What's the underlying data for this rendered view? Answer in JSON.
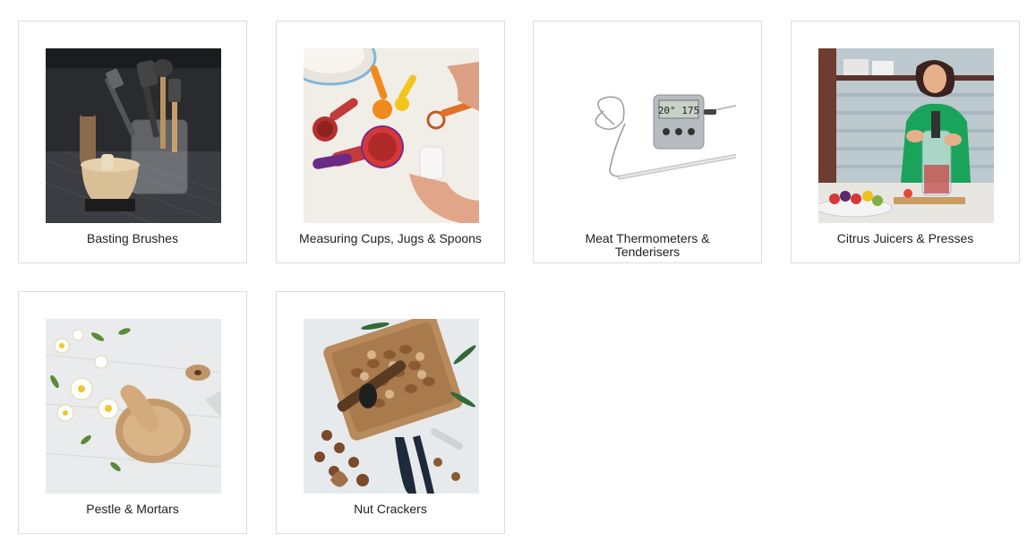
{
  "categories": [
    {
      "label": "Basting Brushes"
    },
    {
      "label": "Measuring Cups, Jugs & Spoons"
    },
    {
      "label": "Meat Thermometers & Tenderisers"
    },
    {
      "label": "Citrus Juicers & Presses"
    },
    {
      "label": "Pestle & Mortars"
    },
    {
      "label": "Nut Crackers"
    }
  ],
  "thermometer_display": "20° 175"
}
